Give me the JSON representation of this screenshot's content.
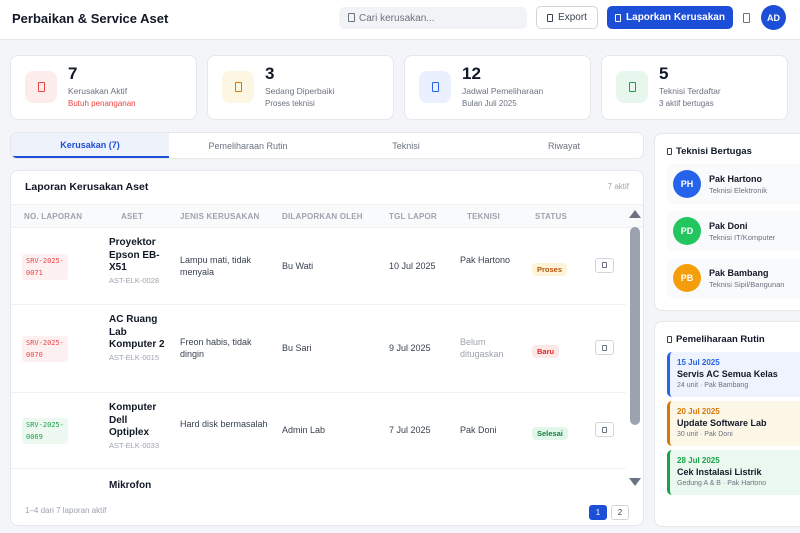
{
  "app": {
    "title": "Perbaikan & Service Aset"
  },
  "search": {
    "placeholder": "Cari kerusakan..."
  },
  "header": {
    "export_label": "Export",
    "report_label": "Laporkan Kerusakan",
    "avatar_initials": "AD"
  },
  "stats": [
    {
      "value": "7",
      "label": "Kerusakan Aktif",
      "sub": "Butuh penanganan",
      "accent": "#ef4444",
      "bg": "#fdecec"
    },
    {
      "value": "3",
      "label": "Sedang Diperbaiki",
      "sub": "Proses teknisi",
      "accent": "#d97706",
      "bg": "#fdf6e3"
    },
    {
      "value": "12",
      "label": "Jadwal Pemeliharaan",
      "sub": "Bulan Juli 2025",
      "accent": "#2563eb",
      "bg": "#eaf0fd"
    },
    {
      "value": "5",
      "label": "Teknisi Terdaftar",
      "sub": "3 aktif bertugas",
      "accent": "#16a34a",
      "bg": "#e8f7ee"
    }
  ],
  "tabs": [
    "Kerusakan (7)",
    "Pemeliharaan Rutin",
    "Teknisi",
    "Riwayat"
  ],
  "table": {
    "title": "Laporan Kerusakan Aset",
    "count": "7 aktif",
    "columns": [
      "NO. LAPORAN",
      "ASET",
      "JENIS KERUSAKAN",
      "DILAPORKAN OLEH",
      "TGL LAPOR",
      "TEKNISI",
      "STATUS"
    ],
    "rows": [
      {
        "no": "SRV-2025-0071",
        "asset": "Proyektor Epson EB-X51",
        "code": "AST-ELK-0028",
        "issue": "Lampu mati, tidak menyala",
        "reporter": "Bu Wati",
        "date": "10 Jul 2025",
        "tech": "Pak Hartono",
        "status": "Proses"
      },
      {
        "no": "SRV-2025-0070",
        "asset": "AC Ruang Lab Komputer 2",
        "code": "AST-ELK-0015",
        "issue": "Freon habis, tidak dingin",
        "reporter": "Bu Sari",
        "date": "9 Jul 2025",
        "tech": "Belum ditugaskan",
        "status": "Baru"
      },
      {
        "no": "SRV-2025-0069",
        "asset": "Komputer Dell Optiplex",
        "code": "AST-ELK-0033",
        "issue": "Hard disk bermasalah",
        "reporter": "Admin Lab",
        "date": "7 Jul 2025",
        "tech": "Pak Doni",
        "status": "Selesai"
      },
      {
        "no": "",
        "asset": "Mikrofon",
        "code": "",
        "issue": "",
        "reporter": "",
        "date": "",
        "tech": "",
        "status": ""
      }
    ],
    "footer": "1–4 dari 7 laporan aktif",
    "pages": [
      "1",
      "2"
    ]
  },
  "status_colors": {
    "Proses": {
      "fg": "#b45309",
      "bg": "#fdf3d8"
    },
    "Baru": {
      "fg": "#dc2626",
      "bg": "#fde8e8"
    },
    "Selesai": {
      "fg": "#15803d",
      "bg": "#e3f6ea"
    }
  },
  "badge_colors": [
    "#ef4444",
    "#ef4444",
    "#16a34a"
  ],
  "technicians": {
    "title": "Teknisi Bertugas",
    "items": [
      {
        "initials": "PH",
        "name": "Pak Hartono",
        "role": "Teknisi Elektronik",
        "color": "#2563eb"
      },
      {
        "initials": "PD",
        "name": "Pak Doni",
        "role": "Teknisi IT/Komputer",
        "color": "#22c55e"
      },
      {
        "initials": "PB",
        "name": "Pak Bambang",
        "role": "Teknisi Sipil/Bangunan",
        "color": "#f59e0b"
      }
    ]
  },
  "maintenance": {
    "title": "Pemeliharaan Rutin",
    "items": [
      {
        "date": "15 Jul 2025",
        "title": "Servis AC Semua Kelas",
        "meta": "24 unit · Pak Bambang",
        "color": "#2563eb",
        "bg": "#eef3fd"
      },
      {
        "date": "20 Jul 2025",
        "title": "Update Software Lab",
        "meta": "30 unit · Pak Doni",
        "color": "#d97706",
        "bg": "#fdf7e8"
      },
      {
        "date": "28 Jul 2025",
        "title": "Cek Instalasi Listrik",
        "meta": "Gedung A & B · Pak Hartono",
        "color": "#16a34a",
        "bg": "#ebf8f0"
      }
    ]
  }
}
